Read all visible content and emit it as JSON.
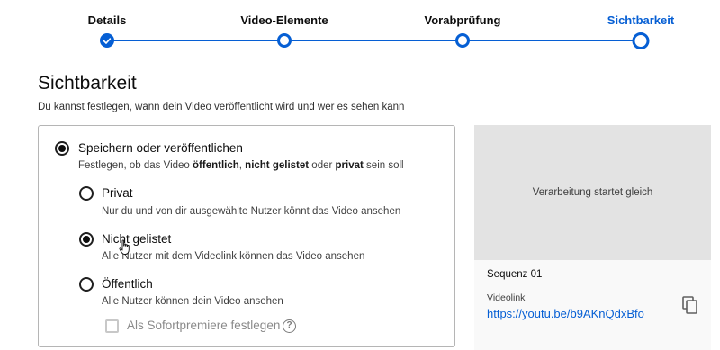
{
  "stepper": {
    "steps": [
      {
        "label": "Details",
        "state": "done"
      },
      {
        "label": "Video-Elemente",
        "state": "visited"
      },
      {
        "label": "Vorabprüfung",
        "state": "visited"
      },
      {
        "label": "Sichtbarkeit",
        "state": "current"
      }
    ],
    "accent_color": "#065fd4"
  },
  "page": {
    "title": "Sichtbarkeit",
    "subtitle": "Du kannst festlegen, wann dein Video veröffentlicht wird und wer es sehen kann"
  },
  "save_publish": {
    "label": "Speichern oder veröffentlichen",
    "desc_prefix": "Festlegen, ob das Video ",
    "desc_bold1": "öffentlich",
    "desc_sep1": ", ",
    "desc_bold2": "nicht gelistet",
    "desc_sep2": " oder ",
    "desc_bold3": "privat",
    "desc_suffix": " sein soll",
    "selected": true
  },
  "options": [
    {
      "label": "Privat",
      "desc": "Nur du und von dir ausgewählte Nutzer könnt das Video ansehen",
      "selected": false
    },
    {
      "label": "Nicht gelistet",
      "desc": "Alle Nutzer mit dem Videolink können das Video ansehen",
      "selected": true
    },
    {
      "label": "Öffentlich",
      "desc": "Alle Nutzer können dein Video ansehen",
      "selected": false
    }
  ],
  "premiere": {
    "label": "Als Sofortpremiere festlegen",
    "checked": false,
    "disabled": true,
    "help_glyph": "?"
  },
  "preview": {
    "status": "Verarbeitung startet gleich",
    "sequence": "Sequenz 01",
    "videolink_label": "Videolink",
    "videolink_url": "https://youtu.be/b9AKnQdxBfo"
  }
}
